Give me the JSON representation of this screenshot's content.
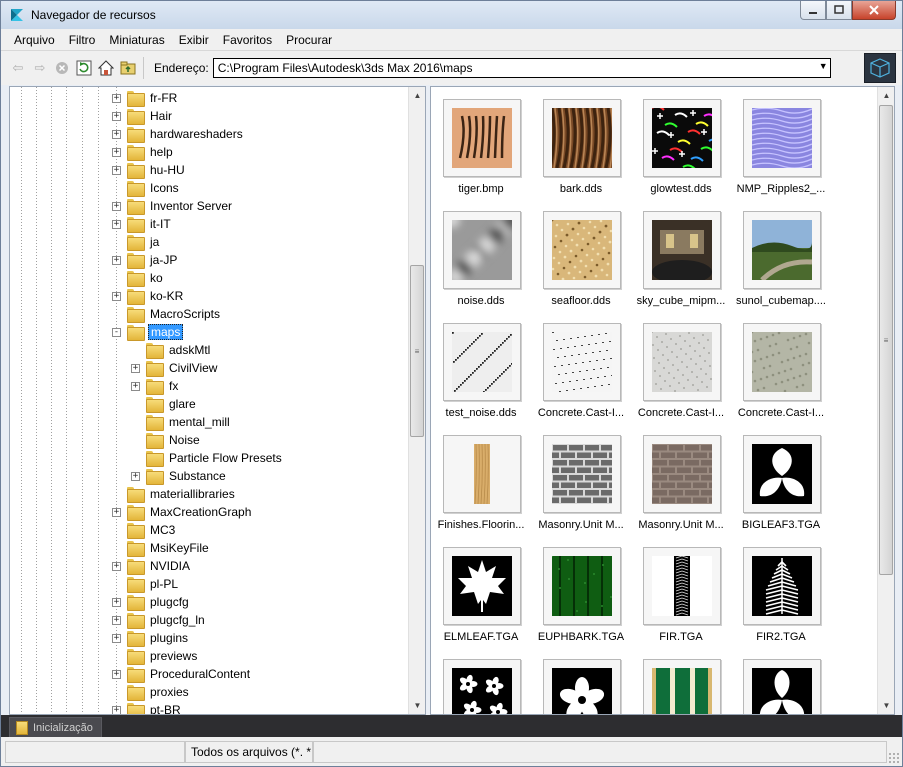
{
  "window": {
    "title": "Navegador de recursos"
  },
  "menu": [
    "Arquivo",
    "Filtro",
    "Miniaturas",
    "Exibir",
    "Favoritos",
    "Procurar"
  ],
  "toolbar": {
    "address_label": "Endereço:",
    "address_value": "C:\\Program Files\\Autodesk\\3ds Max 2016\\maps"
  },
  "tree": [
    {
      "label": "fr-FR",
      "expander": "+",
      "level": 0
    },
    {
      "label": "Hair",
      "expander": "+",
      "level": 0
    },
    {
      "label": "hardwareshaders",
      "expander": "+",
      "level": 0
    },
    {
      "label": "help",
      "expander": "+",
      "level": 0
    },
    {
      "label": "hu-HU",
      "expander": "+",
      "level": 0
    },
    {
      "label": "Icons",
      "expander": "",
      "level": 0
    },
    {
      "label": "Inventor Server",
      "expander": "+",
      "level": 0
    },
    {
      "label": "it-IT",
      "expander": "+",
      "level": 0
    },
    {
      "label": "ja",
      "expander": "",
      "level": 0
    },
    {
      "label": "ja-JP",
      "expander": "+",
      "level": 0
    },
    {
      "label": "ko",
      "expander": "",
      "level": 0
    },
    {
      "label": "ko-KR",
      "expander": "+",
      "level": 0
    },
    {
      "label": "MacroScripts",
      "expander": "",
      "level": 0
    },
    {
      "label": "maps",
      "expander": "-",
      "level": 0,
      "selected": true
    },
    {
      "label": "adskMtl",
      "expander": "",
      "level": 1
    },
    {
      "label": "CivilView",
      "expander": "+",
      "level": 1
    },
    {
      "label": "fx",
      "expander": "+",
      "level": 1
    },
    {
      "label": "glare",
      "expander": "",
      "level": 1
    },
    {
      "label": "mental_mill",
      "expander": "",
      "level": 1
    },
    {
      "label": "Noise",
      "expander": "",
      "level": 1
    },
    {
      "label": "Particle Flow Presets",
      "expander": "",
      "level": 1
    },
    {
      "label": "Substance",
      "expander": "+",
      "level": 1
    },
    {
      "label": "materiallibraries",
      "expander": "",
      "level": 0
    },
    {
      "label": "MaxCreationGraph",
      "expander": "+",
      "level": 0
    },
    {
      "label": "MC3",
      "expander": "",
      "level": 0
    },
    {
      "label": "MsiKeyFile",
      "expander": "",
      "level": 0
    },
    {
      "label": "NVIDIA",
      "expander": "+",
      "level": 0
    },
    {
      "label": "pl-PL",
      "expander": "",
      "level": 0
    },
    {
      "label": "plugcfg",
      "expander": "+",
      "level": 0
    },
    {
      "label": "plugcfg_ln",
      "expander": "+",
      "level": 0
    },
    {
      "label": "plugins",
      "expander": "+",
      "level": 0
    },
    {
      "label": "previews",
      "expander": "",
      "level": 0
    },
    {
      "label": "ProceduralContent",
      "expander": "+",
      "level": 0
    },
    {
      "label": "proxies",
      "expander": "",
      "level": 0
    },
    {
      "label": "pt-BR",
      "expander": "+",
      "level": 0
    }
  ],
  "thumbnails": [
    {
      "label": "tiger.bmp",
      "kind": "tiger"
    },
    {
      "label": "bark.dds",
      "kind": "bark"
    },
    {
      "label": "glowtest.dds",
      "kind": "glow"
    },
    {
      "label": "NMP_Ripples2_...",
      "kind": "ripples"
    },
    {
      "label": "noise.dds",
      "kind": "noise"
    },
    {
      "label": "seafloor.dds",
      "kind": "seafloor"
    },
    {
      "label": "sky_cube_mipm...",
      "kind": "skycube"
    },
    {
      "label": "sunol_cubemap....",
      "kind": "sunol"
    },
    {
      "label": "test_noise.dds",
      "kind": "testnoise"
    },
    {
      "label": "Concrete.Cast-I...",
      "kind": "concrete1"
    },
    {
      "label": "Concrete.Cast-I...",
      "kind": "concrete2"
    },
    {
      "label": "Concrete.Cast-I...",
      "kind": "concrete3"
    },
    {
      "label": "Finishes.Floorin...",
      "kind": "wood"
    },
    {
      "label": "Masonry.Unit M...",
      "kind": "brick1"
    },
    {
      "label": "Masonry.Unit M...",
      "kind": "brick2"
    },
    {
      "label": "BIGLEAF3.TGA",
      "kind": "bigleaf"
    },
    {
      "label": "ELMLEAF.TGA",
      "kind": "maple"
    },
    {
      "label": "EUPHBARK.TGA",
      "kind": "euph"
    },
    {
      "label": "FIR.TGA",
      "kind": "fir"
    },
    {
      "label": "FIR2.TGA",
      "kind": "fir2"
    },
    {
      "label": "",
      "kind": "flowers"
    },
    {
      "label": "",
      "kind": "flower"
    },
    {
      "label": "",
      "kind": "greenstripes"
    },
    {
      "label": "",
      "kind": "leaves3"
    }
  ],
  "bottom": {
    "tab_label": "Inicialização",
    "status_filter": "Todos os arquivos (*. *"
  },
  "colors": {
    "selection": "#3399ff",
    "tabstrip": "#2d2d30"
  }
}
